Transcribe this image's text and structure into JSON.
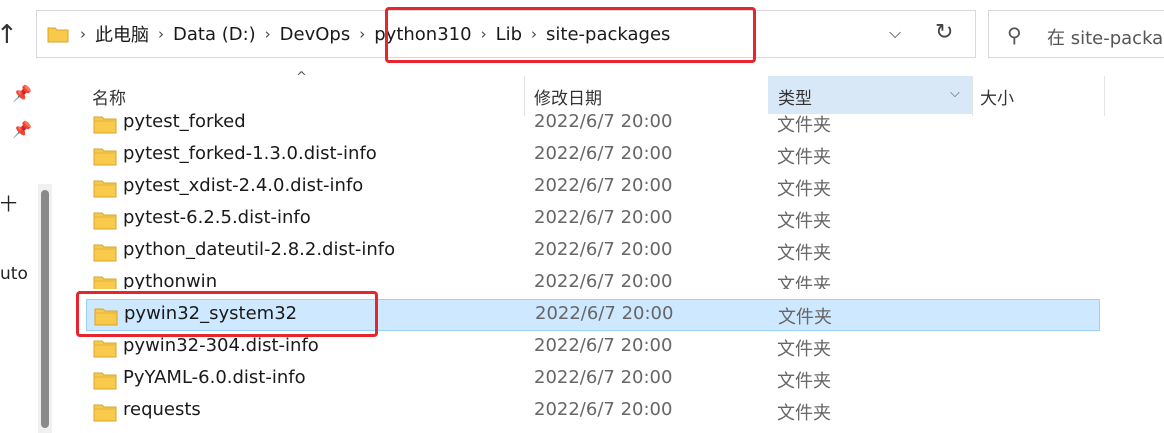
{
  "nav": {
    "up_icon": "up-arrow-icon"
  },
  "address": {
    "breadcrumbs": [
      "此电脑",
      "Data (D:)",
      "DevOps",
      "python310",
      "Lib",
      "site-packages"
    ],
    "separator": "›",
    "dropdown_icon": "chevron-down-icon",
    "refresh_icon": "refresh-icon",
    "highlight_color": "#e8242e"
  },
  "search": {
    "placeholder": "在 site-packages 中搜索",
    "visible_text": "在 site-packag"
  },
  "left_pane": {
    "text_1": "十",
    "text_2": "uto"
  },
  "columns": {
    "name": "名称",
    "date": "修改日期",
    "type": "类型",
    "size": "大小"
  },
  "files": [
    {
      "name": "pytest_forked",
      "date": "2022/6/7 20:00",
      "type": "文件夹"
    },
    {
      "name": "pytest_forked-1.3.0.dist-info",
      "date": "2022/6/7 20:00",
      "type": "文件夹"
    },
    {
      "name": "pytest_xdist-2.4.0.dist-info",
      "date": "2022/6/7 20:00",
      "type": "文件夹"
    },
    {
      "name": "pytest-6.2.5.dist-info",
      "date": "2022/6/7 20:00",
      "type": "文件夹"
    },
    {
      "name": "python_dateutil-2.8.2.dist-info",
      "date": "2022/6/7 20:00",
      "type": "文件夹"
    },
    {
      "name": "pythonwin",
      "date": "2022/6/7 20:00",
      "type": "文件夹"
    },
    {
      "name": "pywin32_system32",
      "date": "2022/6/7 20:00",
      "type": "文件夹",
      "selected": true
    },
    {
      "name": "pywin32-304.dist-info",
      "date": "2022/6/7 20:00",
      "type": "文件夹"
    },
    {
      "name": "PyYAML-6.0.dist-info",
      "date": "2022/6/7 20:00",
      "type": "文件夹"
    },
    {
      "name": "requests",
      "date": "2022/6/7 20:00",
      "type": "文件夹"
    }
  ],
  "colors": {
    "selection": "#cde8ff",
    "folder": "#f8c94a",
    "annotation": "#e8242e"
  }
}
